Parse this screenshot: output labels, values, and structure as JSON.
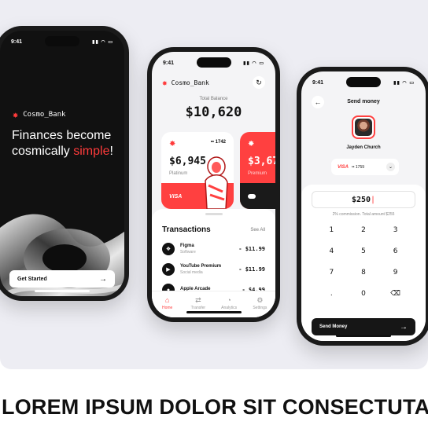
{
  "caption": "LOREM IPSUM DOLOR SIT CONSECTUTAR",
  "colors": {
    "accent": "#ff4040",
    "dark": "#111111",
    "background": "#ededf3"
  },
  "phone_welcome": {
    "status_time": "9:41",
    "brand": "Cosmo_Bank",
    "headline_prefix": "Finances become cosmically ",
    "headline_accent": "simple",
    "headline_suffix": "!",
    "cta_label": "Get Started",
    "cta_icon": "arrow-right-icon"
  },
  "phone_home": {
    "status_time": "9:41",
    "brand": "Cosmo_Bank",
    "balance_label": "Total Balance",
    "balance": "$10,620",
    "cards": [
      {
        "number": "•• 1742",
        "amount": "$6,945",
        "tier": "Platinum",
        "network": "VISA"
      },
      {
        "amount": "$3,67",
        "tier": "Premium"
      }
    ],
    "transactions_title": "Transactions",
    "see_all": "See All",
    "transactions": [
      {
        "name": "Figma",
        "category": "Software",
        "amount": "- $11.99",
        "icon": "figma-icon"
      },
      {
        "name": "YouTube Premium",
        "category": "Social media",
        "amount": "- $11.99",
        "icon": "play-icon"
      },
      {
        "name": "Apple Arcade",
        "category": "",
        "amount": "- $4.99",
        "icon": "apple-icon"
      }
    ],
    "tabs": [
      {
        "label": "Home",
        "icon": "home-icon",
        "active": true
      },
      {
        "label": "Transfer",
        "icon": "transfer-icon",
        "active": false
      },
      {
        "label": "Analytics",
        "icon": "analytics-icon",
        "active": false
      },
      {
        "label": "Settings",
        "icon": "settings-icon",
        "active": false
      }
    ]
  },
  "phone_send": {
    "status_time": "9:41",
    "title": "Send money",
    "recipient": "Jayden Church",
    "card_network": "VISA",
    "card_number": "•• 1759",
    "amount": "$250",
    "commission": "2% commission. Total amount $255",
    "keys": [
      "1",
      "2",
      "3",
      "4",
      "5",
      "6",
      "7",
      "8",
      "9",
      ".",
      "0",
      "⌫"
    ],
    "send_label": "Send Money"
  }
}
